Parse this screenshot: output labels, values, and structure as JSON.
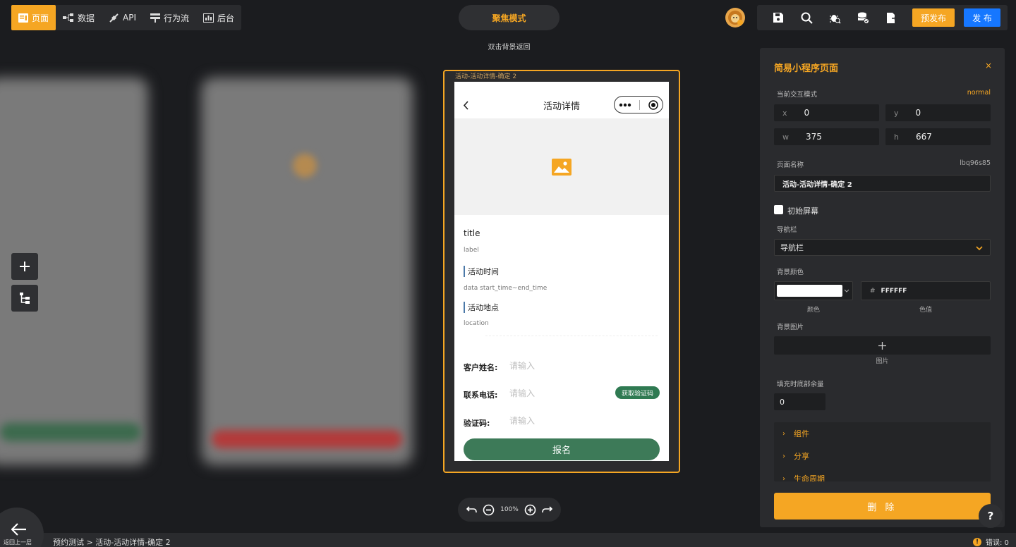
{
  "topnav": {
    "items": [
      {
        "label": "页面",
        "icon": "page-icon"
      },
      {
        "label": "数据",
        "icon": "data-icon"
      },
      {
        "label": "API",
        "icon": "api-icon"
      },
      {
        "label": "行为流",
        "icon": "flow-icon"
      },
      {
        "label": "后台",
        "icon": "backend-icon"
      }
    ],
    "active_index": 0
  },
  "focus_mode": {
    "label": "聚焦模式",
    "hint": "双击背景返回"
  },
  "toolbar": {
    "icons": [
      "save-icon",
      "search-icon",
      "debug-icon",
      "database-icon",
      "export-icon"
    ],
    "prepublish_label": "预发布",
    "publish_label": "发 布"
  },
  "canvas": {
    "frame_label": "活动-活动详情-确定 2",
    "phone": {
      "nav_title": "活动详情",
      "title": "title",
      "label": "label",
      "section_time": "活动时间",
      "time_value": "data start_time~end_time",
      "section_location": "活动地点",
      "location_value": "location",
      "form": {
        "name_label": "客户姓名:",
        "name_placeholder": "请输入",
        "phone_label": "联系电话:",
        "phone_placeholder": "请输入",
        "code_button": "获取验证码",
        "code_label": "验证码:",
        "code_placeholder": "请输入",
        "submit": "报名"
      }
    }
  },
  "zoom": {
    "level": "100%"
  },
  "panel": {
    "title": "简易小程序页面",
    "close": "×",
    "mode_label": "当前交互模式",
    "mode_value": "normal",
    "x_label": "x",
    "x_value": "0",
    "y_label": "y",
    "y_value": "0",
    "w_label": "w",
    "w_value": "375",
    "h_label": "h",
    "h_value": "667",
    "page_name_label": "页面名称",
    "page_id": "lbq96s85",
    "page_name_value": "活动-活动详情-确定 2",
    "initial_screen": "初始屏幕",
    "navbar_label": "导航栏",
    "navbar_value": "导航栏",
    "bg_color_label": "背景颜色",
    "color_caption": "颜色",
    "color_hash": "#",
    "color_value": "FFFFFF",
    "color_value_caption": "色值",
    "bg_image_label": "背景图片",
    "image_caption": "图片",
    "fill_label": "填充时底部余量",
    "fill_value": "0",
    "sections": [
      "组件",
      "分享",
      "生命周期"
    ],
    "delete_label": "删 除",
    "swatch_color": "#FFFFFF"
  },
  "help": "?",
  "status": {
    "back_label": "返回上一层",
    "breadcrumb": "预约测试 > 活动-活动详情-确定 2",
    "errors": "错误: 0",
    "error_icon": "!"
  },
  "colors": {
    "accent": "#f5a623",
    "primary": "#1677ff",
    "submit_green": "#3d7a58"
  }
}
